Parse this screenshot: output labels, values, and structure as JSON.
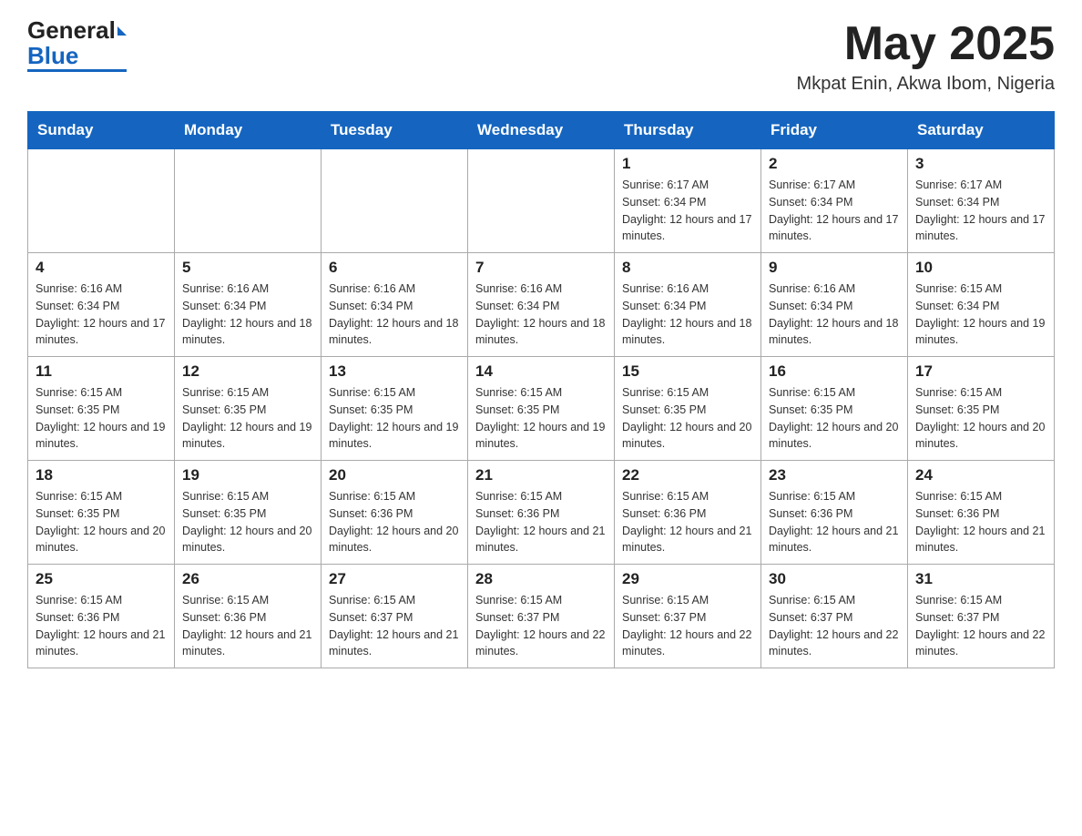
{
  "logo": {
    "general": "General",
    "blue": "Blue"
  },
  "header": {
    "month": "May 2025",
    "location": "Mkpat Enin, Akwa Ibom, Nigeria"
  },
  "days_of_week": [
    "Sunday",
    "Monday",
    "Tuesday",
    "Wednesday",
    "Thursday",
    "Friday",
    "Saturday"
  ],
  "weeks": [
    [
      {
        "day": "",
        "info": ""
      },
      {
        "day": "",
        "info": ""
      },
      {
        "day": "",
        "info": ""
      },
      {
        "day": "",
        "info": ""
      },
      {
        "day": "1",
        "info": "Sunrise: 6:17 AM\nSunset: 6:34 PM\nDaylight: 12 hours and 17 minutes."
      },
      {
        "day": "2",
        "info": "Sunrise: 6:17 AM\nSunset: 6:34 PM\nDaylight: 12 hours and 17 minutes."
      },
      {
        "day": "3",
        "info": "Sunrise: 6:17 AM\nSunset: 6:34 PM\nDaylight: 12 hours and 17 minutes."
      }
    ],
    [
      {
        "day": "4",
        "info": "Sunrise: 6:16 AM\nSunset: 6:34 PM\nDaylight: 12 hours and 17 minutes."
      },
      {
        "day": "5",
        "info": "Sunrise: 6:16 AM\nSunset: 6:34 PM\nDaylight: 12 hours and 18 minutes."
      },
      {
        "day": "6",
        "info": "Sunrise: 6:16 AM\nSunset: 6:34 PM\nDaylight: 12 hours and 18 minutes."
      },
      {
        "day": "7",
        "info": "Sunrise: 6:16 AM\nSunset: 6:34 PM\nDaylight: 12 hours and 18 minutes."
      },
      {
        "day": "8",
        "info": "Sunrise: 6:16 AM\nSunset: 6:34 PM\nDaylight: 12 hours and 18 minutes."
      },
      {
        "day": "9",
        "info": "Sunrise: 6:16 AM\nSunset: 6:34 PM\nDaylight: 12 hours and 18 minutes."
      },
      {
        "day": "10",
        "info": "Sunrise: 6:15 AM\nSunset: 6:34 PM\nDaylight: 12 hours and 19 minutes."
      }
    ],
    [
      {
        "day": "11",
        "info": "Sunrise: 6:15 AM\nSunset: 6:35 PM\nDaylight: 12 hours and 19 minutes."
      },
      {
        "day": "12",
        "info": "Sunrise: 6:15 AM\nSunset: 6:35 PM\nDaylight: 12 hours and 19 minutes."
      },
      {
        "day": "13",
        "info": "Sunrise: 6:15 AM\nSunset: 6:35 PM\nDaylight: 12 hours and 19 minutes."
      },
      {
        "day": "14",
        "info": "Sunrise: 6:15 AM\nSunset: 6:35 PM\nDaylight: 12 hours and 19 minutes."
      },
      {
        "day": "15",
        "info": "Sunrise: 6:15 AM\nSunset: 6:35 PM\nDaylight: 12 hours and 20 minutes."
      },
      {
        "day": "16",
        "info": "Sunrise: 6:15 AM\nSunset: 6:35 PM\nDaylight: 12 hours and 20 minutes."
      },
      {
        "day": "17",
        "info": "Sunrise: 6:15 AM\nSunset: 6:35 PM\nDaylight: 12 hours and 20 minutes."
      }
    ],
    [
      {
        "day": "18",
        "info": "Sunrise: 6:15 AM\nSunset: 6:35 PM\nDaylight: 12 hours and 20 minutes."
      },
      {
        "day": "19",
        "info": "Sunrise: 6:15 AM\nSunset: 6:35 PM\nDaylight: 12 hours and 20 minutes."
      },
      {
        "day": "20",
        "info": "Sunrise: 6:15 AM\nSunset: 6:36 PM\nDaylight: 12 hours and 20 minutes."
      },
      {
        "day": "21",
        "info": "Sunrise: 6:15 AM\nSunset: 6:36 PM\nDaylight: 12 hours and 21 minutes."
      },
      {
        "day": "22",
        "info": "Sunrise: 6:15 AM\nSunset: 6:36 PM\nDaylight: 12 hours and 21 minutes."
      },
      {
        "day": "23",
        "info": "Sunrise: 6:15 AM\nSunset: 6:36 PM\nDaylight: 12 hours and 21 minutes."
      },
      {
        "day": "24",
        "info": "Sunrise: 6:15 AM\nSunset: 6:36 PM\nDaylight: 12 hours and 21 minutes."
      }
    ],
    [
      {
        "day": "25",
        "info": "Sunrise: 6:15 AM\nSunset: 6:36 PM\nDaylight: 12 hours and 21 minutes."
      },
      {
        "day": "26",
        "info": "Sunrise: 6:15 AM\nSunset: 6:36 PM\nDaylight: 12 hours and 21 minutes."
      },
      {
        "day": "27",
        "info": "Sunrise: 6:15 AM\nSunset: 6:37 PM\nDaylight: 12 hours and 21 minutes."
      },
      {
        "day": "28",
        "info": "Sunrise: 6:15 AM\nSunset: 6:37 PM\nDaylight: 12 hours and 22 minutes."
      },
      {
        "day": "29",
        "info": "Sunrise: 6:15 AM\nSunset: 6:37 PM\nDaylight: 12 hours and 22 minutes."
      },
      {
        "day": "30",
        "info": "Sunrise: 6:15 AM\nSunset: 6:37 PM\nDaylight: 12 hours and 22 minutes."
      },
      {
        "day": "31",
        "info": "Sunrise: 6:15 AM\nSunset: 6:37 PM\nDaylight: 12 hours and 22 minutes."
      }
    ]
  ]
}
